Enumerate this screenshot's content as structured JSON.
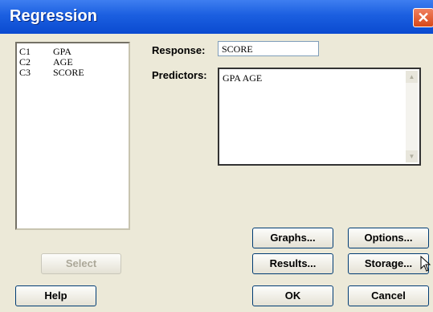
{
  "window": {
    "title": "Regression",
    "close_glyph": "✕"
  },
  "variables": [
    {
      "col": "C1",
      "name": "GPA"
    },
    {
      "col": "C2",
      "name": "AGE"
    },
    {
      "col": "C3",
      "name": "SCORE"
    }
  ],
  "response": {
    "label": "Response:",
    "value": "SCORE"
  },
  "predictors": {
    "label": "Predictors:",
    "value": "GPA AGE"
  },
  "buttons": {
    "select": "Select",
    "graphs": "Graphs...",
    "options": "Options...",
    "results": "Results...",
    "storage": "Storage...",
    "help": "Help",
    "ok": "OK",
    "cancel": "Cancel"
  }
}
